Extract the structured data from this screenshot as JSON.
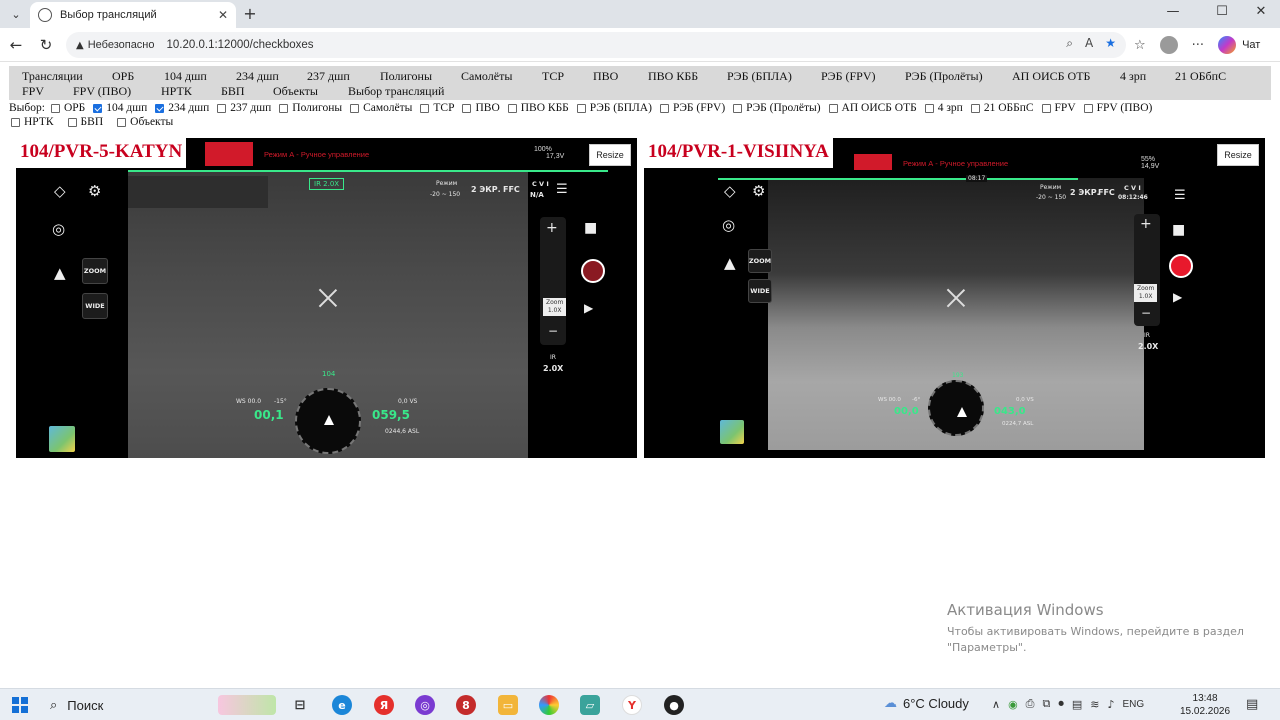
{
  "browser": {
    "tab_title": "Выбор трансляций",
    "tab_close": "✕",
    "new_tab": "+",
    "insecure_label": "Небезопасно",
    "url": "10.20.0.1:12000/checkboxes",
    "chat_label": "Чат",
    "window_controls": [
      "—",
      "☐",
      "✕"
    ]
  },
  "menu": {
    "items": [
      "Трансляции",
      "ОРБ",
      "104 дшп",
      "234 дшп",
      "237 дшп",
      "Полигоны",
      "Самолёты",
      "ТСР",
      "ПВО",
      "ПВО КББ",
      "РЭБ (БПЛА)",
      "РЭБ (FPV)",
      "РЭБ (Пролёты)",
      "АП ОИСБ ОТБ",
      "4 зрп",
      "21 ОБбпС",
      "FPV",
      "FPV (ПВО)",
      "НРТК",
      "БВП",
      "Объекты",
      "Выбор трансляций"
    ]
  },
  "selection": {
    "label": "Выбор:",
    "options": [
      {
        "label": "ОРБ",
        "checked": false
      },
      {
        "label": "104 дшп",
        "checked": true
      },
      {
        "label": "234 дшп",
        "checked": true
      },
      {
        "label": "237 дшп",
        "checked": false
      },
      {
        "label": "Полигоны",
        "checked": false
      },
      {
        "label": "Самолёты",
        "checked": false
      },
      {
        "label": "ТСР",
        "checked": false
      },
      {
        "label": "ПВО",
        "checked": false
      },
      {
        "label": "ПВО КББ",
        "checked": false
      },
      {
        "label": "РЭБ (БПЛА)",
        "checked": false
      },
      {
        "label": "РЭБ (FPV)",
        "checked": false
      },
      {
        "label": "РЭБ (Пролёты)",
        "checked": false
      },
      {
        "label": "АП ОИСБ ОТБ",
        "checked": false
      },
      {
        "label": "4 зрп",
        "checked": false
      },
      {
        "label": "21 ОББпС",
        "checked": false
      },
      {
        "label": "FPV",
        "checked": false
      },
      {
        "label": "FPV (ПВО)",
        "checked": false
      },
      {
        "label": "НРТК",
        "checked": false
      },
      {
        "label": "БВП",
        "checked": false
      },
      {
        "label": "Объекты",
        "checked": false
      }
    ]
  },
  "streams": [
    {
      "title": "104/PVR-5-KATYN",
      "mode_text": "Режим А - Ручное управление",
      "resize_label": "Resize",
      "battery": "100%",
      "voltage": "17,3V",
      "ir_zoom_top": "IR 2.0X",
      "range_label": "Режим",
      "range": "-20 ~ 150",
      "ekr": "2 ЭКР.",
      "ffc": "FFC",
      "cvi": "C V I",
      "cvi_time": "N/A",
      "zoom_btn": "ZOOM",
      "wide_btn": "WIDE",
      "zoom_level_label": "Zoom",
      "zoom_level": "1.0X",
      "ir_label": "IR",
      "ir_zoom": "2.0X",
      "heading": "104",
      "ws": "WS 00.0",
      "pitch": "-15°",
      "speed": "00,1",
      "vs": "0,0 VS",
      "altitude": "059,5",
      "asl": "0244,6 ASL"
    },
    {
      "title": "104/PVR-1-VISIINYA",
      "mode_text": "Режим А - Ручное управление",
      "resize_label": "Resize",
      "battery": "55%",
      "voltage": "14,9V",
      "ir_zoom_top": "08:17",
      "range_label": "Режим",
      "range": "-20 ~ 150",
      "ekr": "2 ЭКР.",
      "ffc": "FFC",
      "cvi": "C V I",
      "cvi_time": "08:12:46",
      "zoom_btn": "ZOOM",
      "wide_btn": "WIDE",
      "zoom_level_label": "Zoom",
      "zoom_level": "1.0X",
      "ir_label": "IR",
      "ir_zoom": "2.0X",
      "heading": "193",
      "ws": "WS 00.0",
      "pitch": "-6°",
      "speed": "00,0",
      "vs": "0,0 VS",
      "altitude": "043,0",
      "asl": "0224,7 ASL"
    }
  ],
  "activation": {
    "title": "Активация Windows",
    "subtitle": "Чтобы активировать Windows, перейдите в раздел \"Параметры\"."
  },
  "taskbar": {
    "search": "Поиск",
    "weather": "6°C  Cloudy",
    "lang": "ENG",
    "time": "13:48",
    "date": "15.02.2026"
  }
}
